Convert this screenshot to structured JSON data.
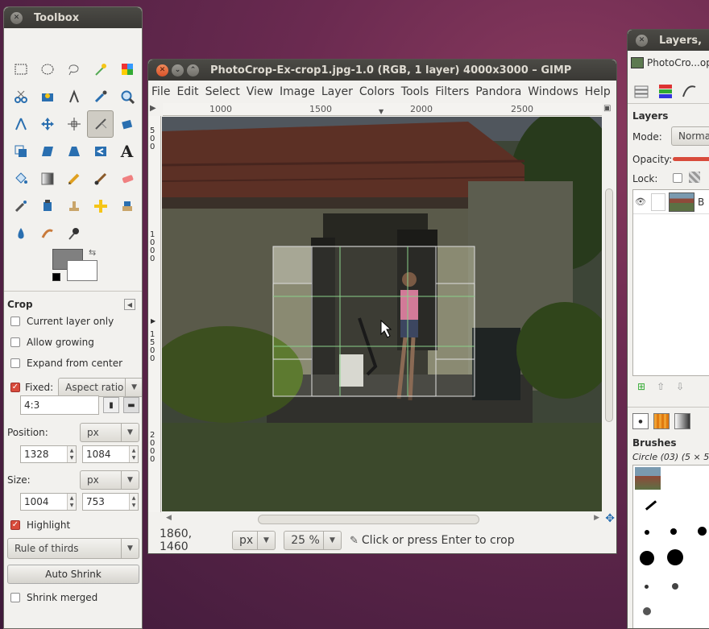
{
  "toolbox": {
    "title": "Toolbox",
    "tool_options_title": "Crop",
    "options": {
      "current_layer_only": "Current layer only",
      "allow_growing": "Allow growing",
      "expand_from_center": "Expand from center",
      "fixed_label": "Fixed:",
      "fixed_value": "Aspect ratio",
      "ratio_value": "4:3",
      "position_label": "Position:",
      "position_unit": "px",
      "position_x": "1328",
      "position_y": "1084",
      "size_label": "Size:",
      "size_unit": "px",
      "size_w": "1004",
      "size_h": "753",
      "highlight": "Highlight",
      "guides_value": "Rule of thirds",
      "auto_shrink": "Auto Shrink",
      "shrink_merged": "Shrink merged"
    }
  },
  "image_window": {
    "title": "PhotoCrop-Ex-crop1.jpg-1.0 (RGB, 1 layer) 4000x3000 – GIMP",
    "menu": [
      "File",
      "Edit",
      "Select",
      "View",
      "Image",
      "Layer",
      "Colors",
      "Tools",
      "Filters",
      "Pandora",
      "Windows",
      "Help"
    ],
    "ruler_ticks": [
      "1000",
      "1500",
      "2000",
      "2500"
    ],
    "vruler_labels": [
      "5\n0\n0",
      "1\n0\n0\n0",
      "1\n5\n0\n0",
      "2\n0\n0\n0"
    ],
    "status": {
      "coords": "1860, 1460",
      "unit": "px",
      "zoom": "25 %",
      "message": "Click or press Enter to crop"
    }
  },
  "layers_dock": {
    "title": "Layers,",
    "image_menu": "PhotoCro...op",
    "section": "Layers",
    "mode_label": "Mode:",
    "mode_value": "Normal",
    "opacity_label": "Opacity:",
    "lock_label": "Lock:",
    "layer_name": "B",
    "brushes_title": "Brushes",
    "brush_name": "Circle (03) (5 × 5"
  },
  "colors": {
    "accent": "#d84b3b",
    "titlebar": "#3c3b37",
    "panel_bg": "#f2f1ee"
  }
}
